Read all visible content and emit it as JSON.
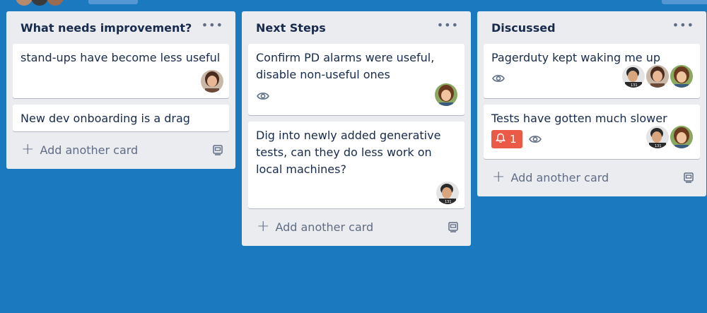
{
  "lists": [
    {
      "title": "What needs improvement?",
      "menu_icon": "ellipsis-icon",
      "cards": [
        {
          "text": "stand-ups have become less useful",
          "members": [
            "woman-1"
          ]
        },
        {
          "text": "New dev onboarding is a drag",
          "members": []
        }
      ],
      "add_label": "Add another card"
    },
    {
      "title": "Next Steps",
      "menu_icon": "ellipsis-icon",
      "cards": [
        {
          "text": "Confirm PD alarms were useful, disable non-useful ones",
          "watched": true,
          "members": [
            "woman-2"
          ]
        },
        {
          "text": "Dig into newly added generative tests, can they do less work on local machines?",
          "members": [
            "man-1"
          ]
        }
      ],
      "add_label": "Add another card"
    },
    {
      "title": "Discussed",
      "menu_icon": "ellipsis-icon",
      "cards": [
        {
          "text": "Pagerduty kept waking me up",
          "watched": true,
          "members": [
            "man-1",
            "woman-1",
            "woman-2"
          ]
        },
        {
          "text": "Tests have gotten much slower",
          "alert_count": "1",
          "watched": true,
          "members": [
            "man-1",
            "woman-2"
          ]
        }
      ],
      "add_label": "Add another card"
    }
  ],
  "colors": {
    "board_bg": "#1a79bf",
    "list_bg": "#ebecf0",
    "alert": "#eb5a46"
  }
}
